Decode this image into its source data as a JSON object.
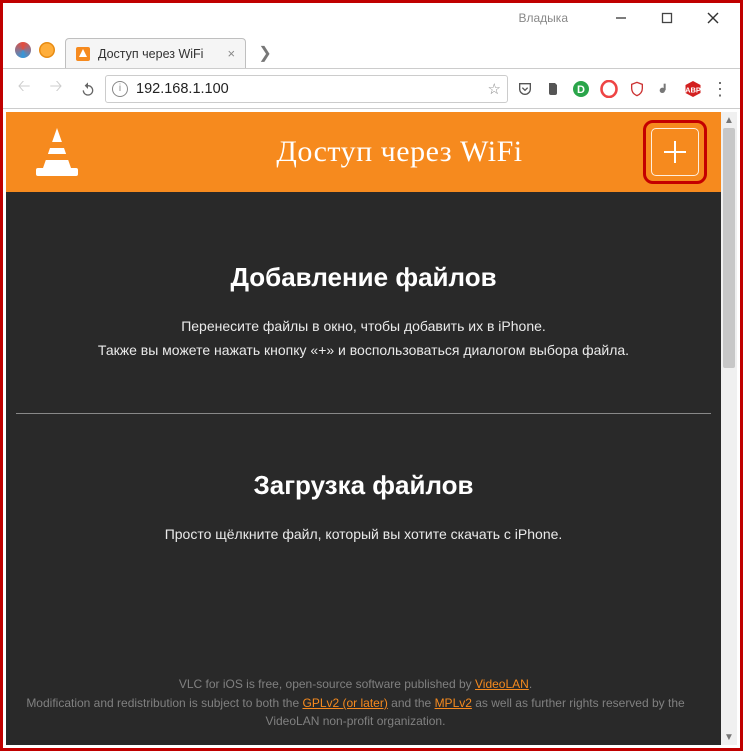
{
  "window": {
    "owner": "Владыка"
  },
  "tab": {
    "title": "Доступ через WiFi"
  },
  "address": {
    "url": "192.168.1.100"
  },
  "page": {
    "header_title": "Доступ через WiFi",
    "upload": {
      "heading": "Добавление файлов",
      "line1": "Перенесите файлы в окно, чтобы добавить их в iPhone.",
      "line2": "Также вы можете нажать кнопку «+» и воспользоваться диалогом выбора файла."
    },
    "download": {
      "heading": "Загрузка файлов",
      "line1": "Просто щёлкните файл, который вы хотите скачать с iPhone."
    },
    "footer": {
      "l1_a": "VLC for iOS is free, open-source software published by ",
      "l1_link": "VideoLAN",
      "l1_b": ".",
      "l2_a": "Modification and redistribution is subject to both the ",
      "l2_link1": "GPLv2 (or later)",
      "l2_mid": " and the ",
      "l2_link2": "MPLv2",
      "l2_b": " as well as further rights reserved by the VideoLAN non-profit organization."
    }
  }
}
